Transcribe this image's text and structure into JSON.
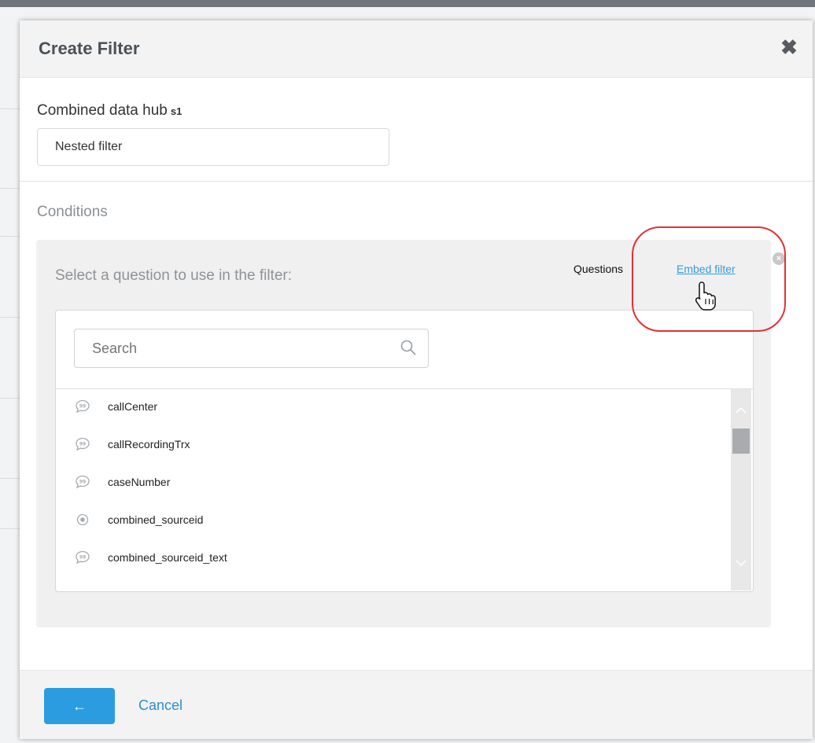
{
  "dialog": {
    "title": "Create Filter",
    "close_icon": "close-icon",
    "close_glyph": "✖"
  },
  "hub": {
    "name": "Combined data hub",
    "suffix": "s1"
  },
  "filter_name_input": {
    "value": "Nested filter"
  },
  "conditions": {
    "heading": "Conditions",
    "prompt": "Select a question to use in the filter:",
    "tabs": {
      "questions": "Questions",
      "embed_filter": "Embed filter"
    },
    "remove_icon": "remove-circle-icon",
    "remove_glyph": "×",
    "search": {
      "placeholder": "Search",
      "icon": "search-icon"
    },
    "questions": [
      {
        "label": "callCenter",
        "icon": "open-text-question-icon"
      },
      {
        "label": "callRecordingTrx",
        "icon": "open-text-question-icon"
      },
      {
        "label": "caseNumber",
        "icon": "open-text-question-icon"
      },
      {
        "label": "combined_sourceid",
        "icon": "single-choice-question-icon"
      },
      {
        "label": "combined_sourceid_text",
        "icon": "open-text-question-icon"
      }
    ]
  },
  "footer": {
    "back_glyph": "←",
    "cancel_label": "Cancel"
  },
  "colors": {
    "accent": "#2b9ce0",
    "link": "#3a9ad9",
    "highlight": "#e53131"
  }
}
